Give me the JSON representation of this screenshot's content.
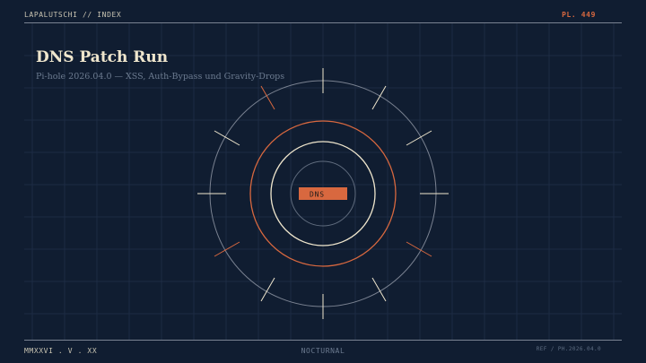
{
  "header": {
    "left": "LAPALUTSCHI // INDEX",
    "right": "PL. 449"
  },
  "title": "DNS Patch Run",
  "subtitle": "Pi-hole 2026.04.0 — XSS, Auth-Bypass und Gravity-Drops",
  "dial": {
    "label": "DNS"
  },
  "footer": {
    "left": "MMXXVI . V . XX",
    "center": "NOCTURNAL",
    "right": "REF / PH.2026.04.0"
  },
  "colors": {
    "background": "#101d31",
    "grid": "#1d2c44",
    "accent": "#d8683f",
    "cream": "#efe6cd",
    "ring": "#7a8291",
    "muted": "#6c7b90"
  }
}
